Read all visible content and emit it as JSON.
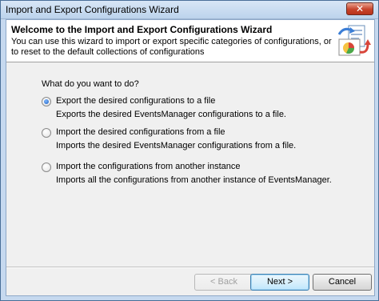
{
  "window": {
    "title": "Import and Export Configurations Wizard",
    "close_glyph": "✕"
  },
  "header": {
    "title": "Welcome to the Import and Export Configurations Wizard",
    "description": "You can use this wizard to import or export specific categories of configurations, or to reset to the default collections of configurations",
    "icon": "configuration-wizard-icon"
  },
  "prompt": "What do you want to do?",
  "options": [
    {
      "label": "Export the desired configurations to a file",
      "description": "Exports the desired EventsManager configurations to a file.",
      "selected": true
    },
    {
      "label": "Import the desired configurations from a file",
      "description": "Imports the desired EventsManager configurations from a file.",
      "selected": false
    },
    {
      "label": "Import the configurations from another instance",
      "description": "Imports all the configurations from another instance of EventsManager.",
      "selected": false
    }
  ],
  "buttons": {
    "back": "< Back",
    "next": "Next >",
    "cancel": "Cancel"
  },
  "colors": {
    "accent": "#3c7fb1",
    "close": "#c7432a"
  }
}
